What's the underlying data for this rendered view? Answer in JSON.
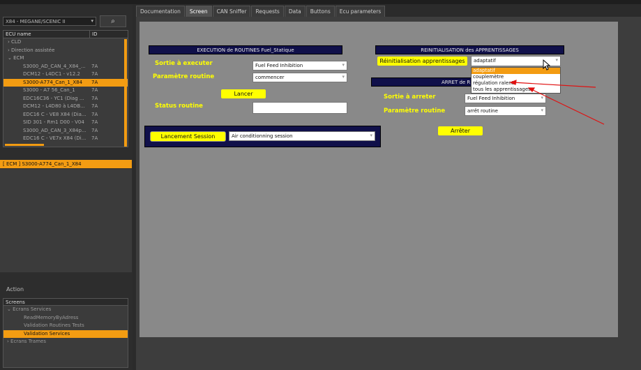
{
  "sidebar": {
    "vehicle": "X84 - MEGANE/SCENIC II",
    "ecu_header": {
      "name": "ECU name",
      "id": "ID"
    },
    "ecu_rows": [
      {
        "name": "CLD",
        "id": "",
        "indent": 1
      },
      {
        "name": "Direction assistée",
        "id": "",
        "indent": 1
      },
      {
        "name": "ECM",
        "id": "",
        "indent": 1
      },
      {
        "name": "S3000_AD_CAN_4_X84_...",
        "id": "7A",
        "indent": 2
      },
      {
        "name": "DCM12 - L4DC1 - v12.2",
        "id": "7A",
        "indent": 2
      },
      {
        "name": "S3000-A774_Can_1_X84",
        "id": "7A",
        "indent": 2,
        "selected": true
      },
      {
        "name": "S3000 - A7 56_Can_1",
        "id": "7A",
        "indent": 2
      },
      {
        "name": "EDC16C36 - YC1 (Diag ...",
        "id": "7A",
        "indent": 2
      },
      {
        "name": "DCM12 - L4D80 à L4DB...",
        "id": "7A",
        "indent": 2
      },
      {
        "name": "EDC16 C - VE8 X84 (Dia...",
        "id": "7A",
        "indent": 2
      },
      {
        "name": "SID 301 - Rm1 D00 - V04",
        "id": "7A",
        "indent": 2
      },
      {
        "name": "S3000_AD_CAN_3_X84p...",
        "id": "7A",
        "indent": 2
      },
      {
        "name": "EDC16 C - VE7x X84 (Di...",
        "id": "7A",
        "indent": 2
      }
    ],
    "selected_ecu": "[ ECM ] S3000-A774_Can_1_X84",
    "action_label": "Action",
    "screens_header": "Screens",
    "screens_rows": [
      {
        "label": "Ecrans Services",
        "indent": 1
      },
      {
        "label": "ReadMemoryByAdress",
        "indent": 2
      },
      {
        "label": "Validation Routines Tests",
        "indent": 2
      },
      {
        "label": "Validation Services",
        "indent": 2,
        "selected": true
      },
      {
        "label": "Ecrans Trames",
        "indent": 1
      }
    ]
  },
  "tabs": [
    {
      "label": "Documentation",
      "active": false
    },
    {
      "label": "Screen",
      "active": true
    },
    {
      "label": "CAN Sniffer",
      "active": false
    },
    {
      "label": "Requests",
      "active": false
    },
    {
      "label": "Data",
      "active": false
    },
    {
      "label": "Buttons",
      "active": false
    },
    {
      "label": "Ecu parameters",
      "active": false
    }
  ],
  "routines": {
    "header": "EXECUTION de ROUTINES Fuel_Statique",
    "sortie_label": "Sortie à executer",
    "sortie_value": "Fuel Feed Inhibition",
    "param_label": "Paramètre routine",
    "param_value": "commencer",
    "lancer_button": "Lancer",
    "status_label": "Status routine",
    "status_value": ""
  },
  "session": {
    "button": "Lancement Session",
    "value": "Air conditionning session"
  },
  "reinit": {
    "header": "REINITIALISATION des APPRENTISSAGES",
    "button": "Réinitialisation apprentissages",
    "value": "adaptatif",
    "options": [
      "adaptatif",
      "couplemètre",
      "régulation ralenti",
      "tous les apprentissages"
    ]
  },
  "arret": {
    "header": "ARRET de R",
    "sortie_label": "Sortie à arreter",
    "sortie_value": "Fuel Feed Inhibition",
    "param_label": "Paramètre routine",
    "param_value": "arrêt routine",
    "button": "Arrêter"
  },
  "colors": {
    "accent": "#f39c12",
    "yellow": "#ffff00",
    "navy": "#10104a",
    "annotation": "#e01010"
  }
}
